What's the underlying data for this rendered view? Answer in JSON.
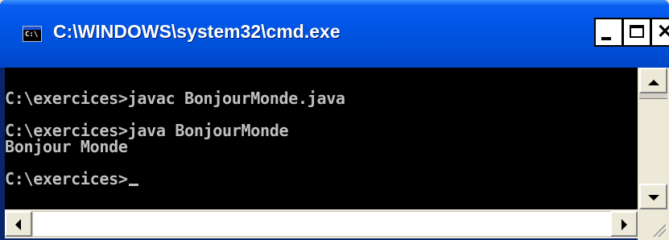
{
  "window": {
    "title": "C:\\WINDOWS\\system32\\cmd.exe",
    "app_icon_label": "C:\\",
    "buttons": {
      "minimize": "minimize-icon",
      "maximize": "maximize-icon",
      "close": "close-icon"
    }
  },
  "console": {
    "lines": [
      "",
      "C:\\exercices>javac BonjourMonde.java",
      "",
      "C:\\exercices>java BonjourMonde",
      "Bonjour Monde",
      "",
      "C:\\exercices>"
    ],
    "text_color": "#c0c0c0",
    "background": "#000000"
  },
  "colors": {
    "titlebar": "#0055e5",
    "chrome": "#ece9d8"
  }
}
